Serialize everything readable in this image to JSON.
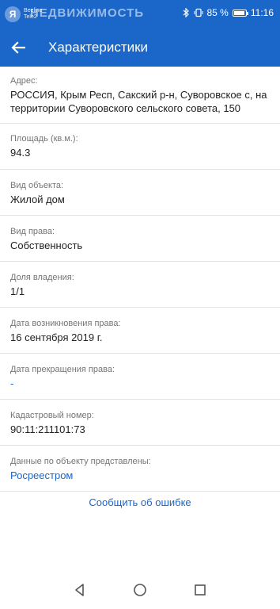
{
  "status_bar": {
    "carrier_line1": "Beeline",
    "carrier_line2": "Tele2",
    "watermark": "НЕДВИЖИМОСТЬ",
    "battery": "85 %",
    "time": "11:16"
  },
  "header": {
    "title": "Характеристики"
  },
  "fields": [
    {
      "label": "Адрес:",
      "value": "РОССИЯ, Крым Респ, Сакский р-н, Суворовское с, на территории Суворовского сельского совета, 150"
    },
    {
      "label": "Площадь (кв.м.):",
      "value": "94.3"
    },
    {
      "label": "Вид объекта:",
      "value": "Жилой дом"
    },
    {
      "label": "Вид права:",
      "value": "Собственность"
    },
    {
      "label": "Доля владения:",
      "value": "1/1"
    },
    {
      "label": "Дата возникновения права:",
      "value": "16 сентября 2019 г."
    },
    {
      "label": "Дата прекращения права:",
      "value": "-"
    },
    {
      "label": "Кадастровый номер:",
      "value": "90:11:211101:73"
    },
    {
      "label": "Данные по объекту представлены:",
      "value": "Росреестром"
    }
  ],
  "report_link": "Сообщить об ошибке",
  "icons": {
    "back": "arrow-left-icon",
    "nav_back": "triangle-back-icon",
    "nav_home": "circle-home-icon",
    "nav_recents": "square-recents-icon"
  },
  "colors": {
    "primary": "#1b66c9",
    "divider": "#e3e3e3",
    "label": "#757575"
  }
}
